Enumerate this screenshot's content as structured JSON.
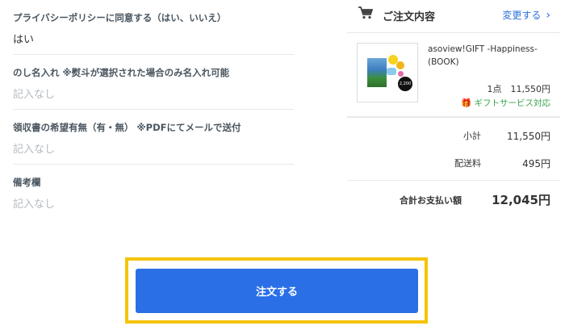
{
  "form": {
    "fields": [
      {
        "label": "プライバシーポリシーに同意する（はい、いいえ）",
        "value": "はい",
        "empty": false
      },
      {
        "label": "のし名入れ ※熨斗が選択された場合のみ名入れ可能",
        "value": "記入なし",
        "empty": true
      },
      {
        "label": "領収書の希望有無（有・無） ※PDFにてメールで送付",
        "value": "記入なし",
        "empty": true
      },
      {
        "label": "備考欄",
        "value": "記入なし",
        "empty": true
      }
    ]
  },
  "order": {
    "title": "ご注文内容",
    "change_link": "変更する",
    "cart_icon": "shopping-cart-icon",
    "item": {
      "name": "asoview!GIFT -Happiness- (BOOK)",
      "thumbnail_price": "2,200",
      "quantity_price": "1点　11,550円",
      "gift_badge": "ギフトサービス対応",
      "gift_icon": "gift-icon"
    },
    "subtotal_label": "小計",
    "subtotal_value": "11,550円",
    "shipping_label": "配送料",
    "shipping_value": "495円",
    "total_label": "合計お支払い額",
    "total_value": "12,045円"
  },
  "cta": {
    "label": "注文する"
  },
  "colors": {
    "accent": "#2a6fe6",
    "link": "#2a6fdb",
    "highlight": "#f5c400",
    "gift_green": "#3aa34b"
  }
}
